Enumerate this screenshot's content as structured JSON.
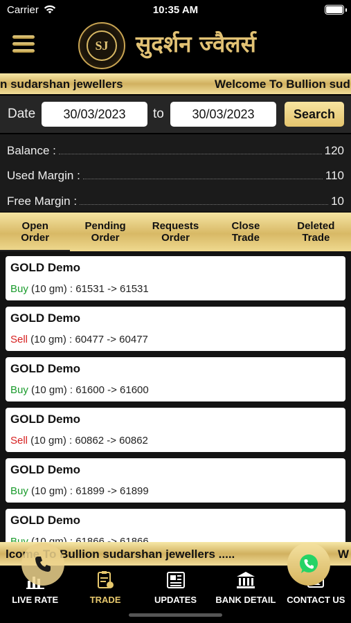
{
  "status": {
    "carrier": "Carrier",
    "time": "10:35 AM"
  },
  "header": {
    "brand": "सुदर्शन ज्वैलर्स",
    "seal_text": "SJ"
  },
  "ticker_top": {
    "text_a": "n sudarshan jewellers",
    "text_b": "Welcome To Bullion sud"
  },
  "filter": {
    "date_label": "Date",
    "from": "30/03/2023",
    "to_label": "to",
    "to": "30/03/2023",
    "search_label": "Search"
  },
  "balance": {
    "balance_label": "Balance :",
    "balance_value": "120",
    "used_label": "Used Margin :",
    "used_value": "110",
    "free_label": "Free Margin :",
    "free_value": "10"
  },
  "tabs": [
    {
      "line1": "Open",
      "line2": "Order"
    },
    {
      "line1": "Pending",
      "line2": "Order"
    },
    {
      "line1": "Requests",
      "line2": "Order"
    },
    {
      "line1": "Close",
      "line2": "Trade"
    },
    {
      "line1": "Deleted",
      "line2": "Trade"
    }
  ],
  "orders": [
    {
      "title": "GOLD Demo",
      "side": "Buy",
      "detail": " (10 gm) : 61531 -> 61531"
    },
    {
      "title": "GOLD Demo",
      "side": "Sell",
      "detail": " (10 gm) : 60477 -> 60477"
    },
    {
      "title": "GOLD Demo",
      "side": "Buy",
      "detail": " (10 gm) : 61600 -> 61600"
    },
    {
      "title": "GOLD Demo",
      "side": "Sell",
      "detail": " (10 gm) : 60862 -> 60862"
    },
    {
      "title": "GOLD Demo",
      "side": "Buy",
      "detail": " (10 gm) : 61899 -> 61899"
    },
    {
      "title": "GOLD Demo",
      "side": "Buy",
      "detail": " (10 gm) : 61866 -> 61866"
    }
  ],
  "ticker_bottom": {
    "text_a": "lcome To Bullion sudarshan jewellers .....",
    "text_b": "W"
  },
  "nav": [
    {
      "label": "LIVE RATE",
      "icon": "chart-icon"
    },
    {
      "label": "TRADE",
      "icon": "trade-icon"
    },
    {
      "label": "UPDATES",
      "icon": "news-icon"
    },
    {
      "label": "BANK DETAIL",
      "icon": "bank-icon"
    },
    {
      "label": "CONTACT US",
      "icon": "contact-icon"
    }
  ],
  "colors": {
    "gold": "#d8b966",
    "buy": "#1a9b2c",
    "sell": "#d62020",
    "whatsapp": "#25d366"
  }
}
